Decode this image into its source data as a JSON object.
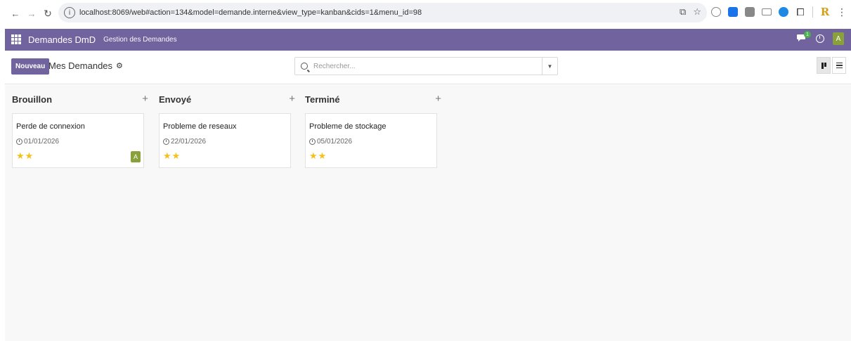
{
  "browser": {
    "url": "localhost:8069/web#action=134&model=demande.interne&view_type=kanban&cids=1&menu_id=98"
  },
  "navbar": {
    "app_name": "Demandes DmD",
    "menu_item": "Gestion des Demandes",
    "chat_badge": "1",
    "avatar_letter": "A",
    "color": "#71639e"
  },
  "control_panel": {
    "new_button": "Nouveau",
    "breadcrumb": "Mes Demandes",
    "search_placeholder": "Rechercher..."
  },
  "columns": [
    {
      "title": "Brouillon",
      "cards": [
        {
          "title": "Perde de connexion",
          "date": "01/01/2026",
          "stars": 2,
          "avatar": "A"
        }
      ]
    },
    {
      "title": "Envoyé",
      "cards": [
        {
          "title": "Probleme de reseaux",
          "date": "22/01/2026",
          "stars": 2
        }
      ]
    },
    {
      "title": "Terminé",
      "cards": [
        {
          "title": "Probleme de stockage",
          "date": "05/01/2026",
          "stars": 2
        }
      ]
    }
  ],
  "colors": {
    "primary": "#71639e",
    "avatar": "#8aa03a",
    "star": "#f3c11c"
  }
}
